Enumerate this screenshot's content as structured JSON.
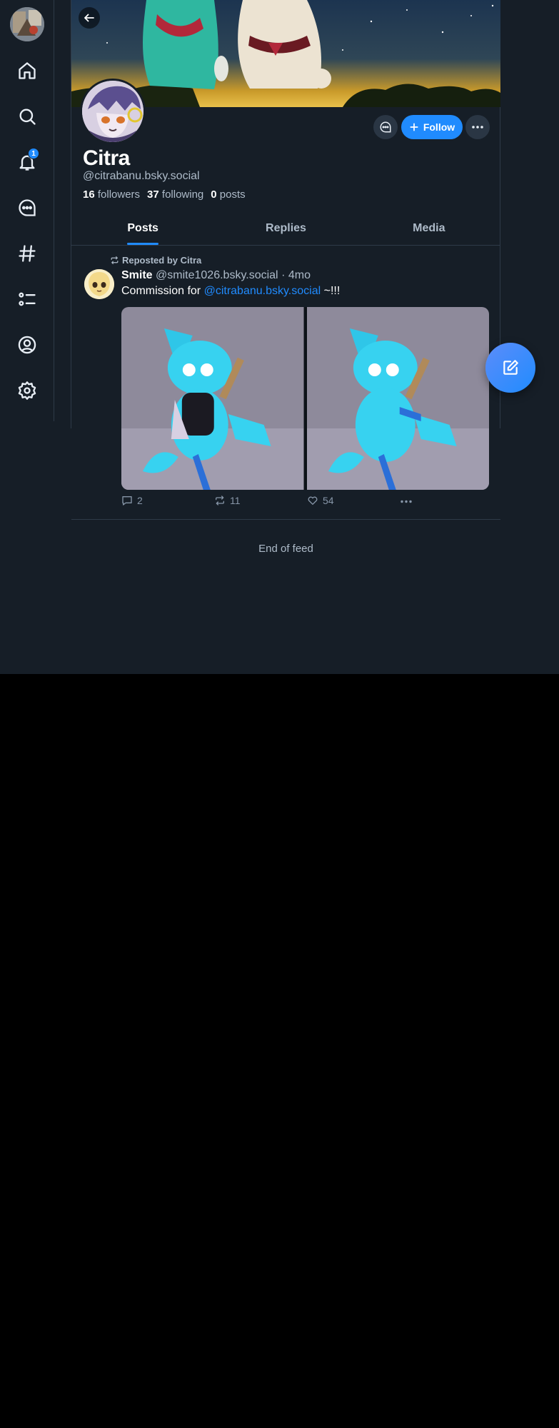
{
  "nav": {
    "notification_count": "1",
    "items": [
      "home",
      "search",
      "notifications",
      "chat",
      "feeds",
      "lists",
      "profile",
      "settings"
    ]
  },
  "profile": {
    "display_name": "Citra",
    "handle": "@citrabanu.bsky.social",
    "followers_count": "16",
    "followers_label": "followers",
    "following_count": "37",
    "following_label": "following",
    "posts_count": "0",
    "posts_label": "posts",
    "follow_label": "Follow"
  },
  "tabs": [
    "Posts",
    "Replies",
    "Media"
  ],
  "post": {
    "repost_label": "Reposted by Citra",
    "author": "Smite",
    "author_handle": "@smite1026.bsky.social",
    "timestamp": "· 4mo",
    "text_before": "Commission for ",
    "mention": "@citrabanu.bsky.social",
    "text_after": " ~!!!",
    "reply_count": "2",
    "repost_count": "11",
    "like_count": "54"
  },
  "feed": {
    "end_label": "End of feed"
  },
  "colors": {
    "accent": "#208bfe",
    "background": "#161e27",
    "muted_text": "#aebbc9"
  }
}
